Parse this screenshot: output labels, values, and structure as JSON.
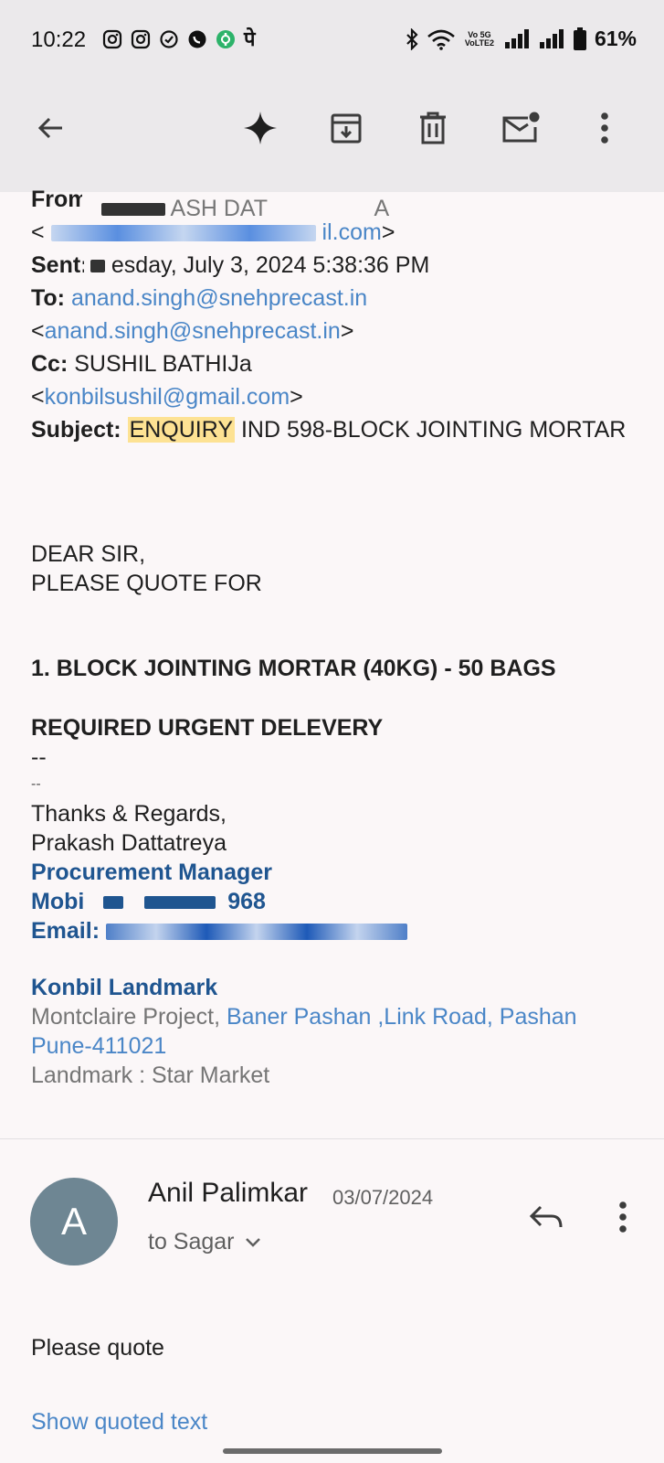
{
  "status_bar": {
    "time": "10:22",
    "network": "Vo 5G VoLTE2",
    "battery": "61%",
    "icons": [
      "instagram-icon",
      "instagram-icon",
      "check-circle-icon",
      "whatsapp-icon",
      "app-icon",
      "pe-icon"
    ]
  },
  "toolbar": {
    "icons": [
      "back-arrow-icon",
      "gemini-sparkle-icon",
      "archive-icon",
      "delete-icon",
      "mark-unread-icon",
      "more-vert-icon"
    ]
  },
  "header": {
    "from_label": "From:",
    "from_name_partial": "ASH DAT",
    "from_name_end": "A",
    "from_email_end": "il.com",
    "sent_label": "Sent:",
    "sent_value": "esday, July 3, 2024 5:38:36 PM",
    "to_label": "To:",
    "to_name": "anand.singh@snehprecast.in",
    "to_email": "anand.singh@snehprecast.in",
    "cc_label": "Cc:",
    "cc_name": "SUSHIL BATHIJa",
    "cc_email": "konbilsushil@gmail.com",
    "subject_label": "Subject:",
    "subject_highlight": "ENQUIRY",
    "subject_rest": " IND 598-BLOCK JOINTING MORTAR"
  },
  "body": {
    "greeting": "DEAR SIR,",
    "request": "PLEASE QUOTE FOR",
    "item": "1. BLOCK JOINTING MORTAR (40KG) - 50 BAGS",
    "urgent": "REQUIRED URGENT DELEVERY",
    "sep1": "--",
    "sep2": "--",
    "regards": "Thanks & Regards,",
    "name": "Prakash Dattatreya",
    "role": "Procurement Manager",
    "mobile_label": "Mobi",
    "mobile_end": "968",
    "email_label": "Email:",
    "company": "Konbil Landmark",
    "address_grey": "Montclaire Project, ",
    "address_link": "Baner Pashan ,Link Road, Pashan Pune-411021",
    "landmark": "Landmark : Star Market"
  },
  "reply_message": {
    "avatar_letter": "A",
    "sender": "Anil Palimkar",
    "date": "03/07/2024",
    "to": "to Sagar",
    "text": "Please quote",
    "show_quoted": "Show quoted text"
  }
}
